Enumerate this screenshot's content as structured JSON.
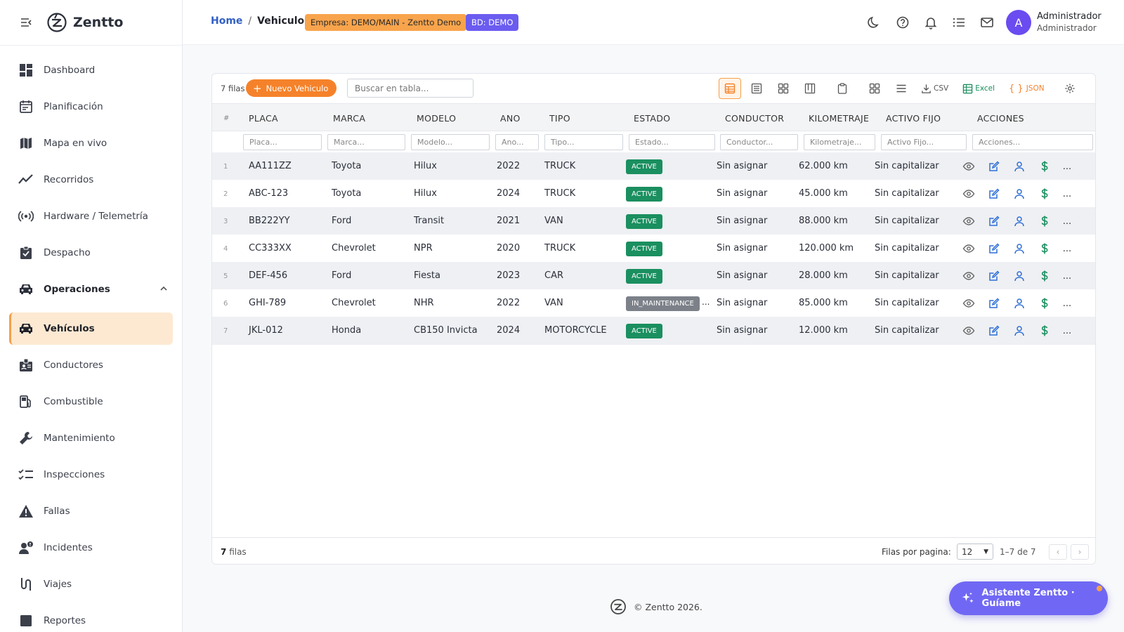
{
  "brand": {
    "name": "Zentto"
  },
  "sidebar": {
    "items": [
      {
        "label": "Dashboard",
        "icon": "dashboard-icon"
      },
      {
        "label": "Planificación",
        "icon": "calendar-icon"
      },
      {
        "label": "Mapa en vivo",
        "icon": "map-icon"
      },
      {
        "label": "Recorridos",
        "icon": "trend-icon"
      },
      {
        "label": "Hardware / Telemetría",
        "icon": "signal-icon"
      },
      {
        "label": "Despacho",
        "icon": "clipboard-check-icon"
      },
      {
        "label": "Operaciones",
        "icon": "car-icon",
        "group": true
      },
      {
        "label": "Vehículos",
        "icon": "car-icon",
        "active": true
      },
      {
        "label": "Conductores",
        "icon": "badge-icon"
      },
      {
        "label": "Combustible",
        "icon": "fuel-icon"
      },
      {
        "label": "Mantenimiento",
        "icon": "wrench-icon"
      },
      {
        "label": "Inspecciones",
        "icon": "checklist-icon"
      },
      {
        "label": "Fallas",
        "icon": "warning-icon"
      },
      {
        "label": "Incidentes",
        "icon": "incident-icon"
      },
      {
        "label": "Viajes",
        "icon": "route-icon"
      },
      {
        "label": "Reportes",
        "icon": "report-icon"
      }
    ]
  },
  "header": {
    "breadcrumb": {
      "home": "Home",
      "sep": "/",
      "current": "Vehiculos"
    },
    "empresa_badge": "Empresa: DEMO/MAIN - Zentto Demo",
    "bd_badge": "BD: DEMO",
    "user": {
      "initial": "A",
      "name": "Administrador",
      "role": "Administrador"
    }
  },
  "toolbar": {
    "row_count": "7 filas",
    "new_button": "Nuevo Vehiculo",
    "search_placeholder": "Buscar en tabla...",
    "csv": "CSV",
    "excel": "Excel",
    "json": "JSON"
  },
  "table": {
    "columns": {
      "idx": "#",
      "placa": "PLACA",
      "marca": "MARCA",
      "modelo": "MODELO",
      "ano": "ANO",
      "tipo": "TIPO",
      "estado": "ESTADO",
      "conductor": "CONDUCTOR",
      "km": "KILOMETRAJE",
      "activo": "ACTIVO FIJO",
      "acciones": "ACCIONES"
    },
    "filters": {
      "placa": "Placa...",
      "marca": "Marca...",
      "modelo": "Modelo...",
      "ano": "Ano...",
      "tipo": "Tipo...",
      "estado": "Estado...",
      "conductor": "Conductor...",
      "km": "Kilometraje...",
      "activo": "Activo Fijo...",
      "acciones": "Acciones..."
    },
    "rows": [
      {
        "idx": "1",
        "placa": "AA111ZZ",
        "marca": "Toyota",
        "modelo": "Hilux",
        "ano": "2022",
        "tipo": "TRUCK",
        "estado": "ACTIVE",
        "conductor": "Sin asignar",
        "km": "62.000 km",
        "activo": "Sin capitalizar"
      },
      {
        "idx": "2",
        "placa": "ABC-123",
        "marca": "Toyota",
        "modelo": "Hilux",
        "ano": "2024",
        "tipo": "TRUCK",
        "estado": "ACTIVE",
        "conductor": "Sin asignar",
        "km": "45.000 km",
        "activo": "Sin capitalizar"
      },
      {
        "idx": "3",
        "placa": "BB222YY",
        "marca": "Ford",
        "modelo": "Transit",
        "ano": "2021",
        "tipo": "VAN",
        "estado": "ACTIVE",
        "conductor": "Sin asignar",
        "km": "88.000 km",
        "activo": "Sin capitalizar"
      },
      {
        "idx": "4",
        "placa": "CC333XX",
        "marca": "Chevrolet",
        "modelo": "NPR",
        "ano": "2020",
        "tipo": "TRUCK",
        "estado": "ACTIVE",
        "conductor": "Sin asignar",
        "km": "120.000 km",
        "activo": "Sin capitalizar"
      },
      {
        "idx": "5",
        "placa": "DEF-456",
        "marca": "Ford",
        "modelo": "Fiesta",
        "ano": "2023",
        "tipo": "CAR",
        "estado": "ACTIVE",
        "conductor": "Sin asignar",
        "km": "28.000 km",
        "activo": "Sin capitalizar"
      },
      {
        "idx": "6",
        "placa": "GHI-789",
        "marca": "Chevrolet",
        "modelo": "NHR",
        "ano": "2022",
        "tipo": "VAN",
        "estado": "IN_MAINTENANCE",
        "conductor": "Sin asignar",
        "km": "85.000 km",
        "activo": "Sin capitalizar"
      },
      {
        "idx": "7",
        "placa": "JKL-012",
        "marca": "Honda",
        "modelo": "CB150 Invicta",
        "ano": "2024",
        "tipo": "MOTORCYCLE",
        "estado": "ACTIVE",
        "conductor": "Sin asignar",
        "km": "12.000 km",
        "activo": "Sin capitalizar"
      }
    ],
    "more_glyph": "...",
    "trunc_glyph": "..."
  },
  "pagination": {
    "count_number": "7",
    "count_label": "filas",
    "rows_per_page_label": "Filas por pagina:",
    "rows_per_page": "12",
    "range": "1–7 de 7",
    "prev": "‹",
    "next": "›"
  },
  "footer": {
    "copyright": "© Zentto 2026."
  },
  "assistant": {
    "label": "Asistente Zentto · Guíame"
  },
  "colors": {
    "accent_orange": "#f5822a",
    "active_nav_bg": "#fde9d2",
    "status_active": "#1a8f5f",
    "status_maintenance": "#7c8189",
    "bd_badge": "#6b5cf0",
    "assistant": "#7068f4"
  }
}
